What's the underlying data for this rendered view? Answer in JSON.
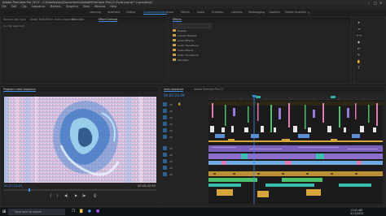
{
  "app": {
    "title": "Adobe Premiere Pro 2017 - C:\\Users\\sopy\\Documents\\Adobe\\Premiere Pro\\11.0\\vid.prproj * (upscaling)"
  },
  "menu": [
    "File",
    "Edit",
    "Clip",
    "Sequence",
    "Markers",
    "Graphics",
    "View",
    "Window",
    "Help"
  ],
  "workspaces": [
    {
      "label": "Learning",
      "active": false
    },
    {
      "label": "Assembly",
      "active": false
    },
    {
      "label": "Editing",
      "active": false
    },
    {
      "label": "Customworkspace",
      "active": true
    },
    {
      "label": "Color",
      "active": false
    },
    {
      "label": "Effects",
      "active": false
    },
    {
      "label": "Audio",
      "active": false
    },
    {
      "label": "Graphics",
      "active": false
    },
    {
      "label": "Libraries",
      "active": false
    },
    {
      "label": "Metalogging",
      "active": false
    },
    {
      "label": "Captions",
      "active": false
    },
    {
      "label": "Motion Graphics",
      "active": false
    }
  ],
  "source_panel": {
    "tabs": [
      "Source: (no clips)",
      "Audio Track Mixer: main sequence",
      "Metadata",
      "Effect Controls"
    ],
    "active_tab": 3,
    "status": "(no clip selected)"
  },
  "effects_panel": {
    "tab": "Effects",
    "search_placeholder": "",
    "folders": [
      "Presets",
      "Lumetri Presets",
      "Audio Effects",
      "Audio Transitions",
      "Video Effects",
      "Video Transitions",
      "Obsolete"
    ]
  },
  "program_monitor": {
    "tab": "Program: main sequence",
    "timecode": "00:07:23:49",
    "duration": "00:03:42:49"
  },
  "timeline": {
    "tabs": [
      "main sequence",
      "Adobe Premiere Pro CC"
    ],
    "timecode": "00:07:23:49",
    "video_tracks": [
      "V6",
      "V5",
      "V4",
      "V3",
      "V2",
      "V1"
    ],
    "audio_tracks": [
      "A1",
      "A2",
      "A3",
      "A4",
      "A5"
    ],
    "colors": {
      "purple": "#9b7bd9",
      "blue": "#5a8fd6",
      "pink": "#e07ab2",
      "green": "#4cc06a",
      "yellow": "#d8a53a",
      "teal": "#3bbfb0"
    }
  },
  "taskbar": {
    "search_placeholder": "Type here to search",
    "time": "11:02 AM",
    "date": "4/11/2022"
  }
}
